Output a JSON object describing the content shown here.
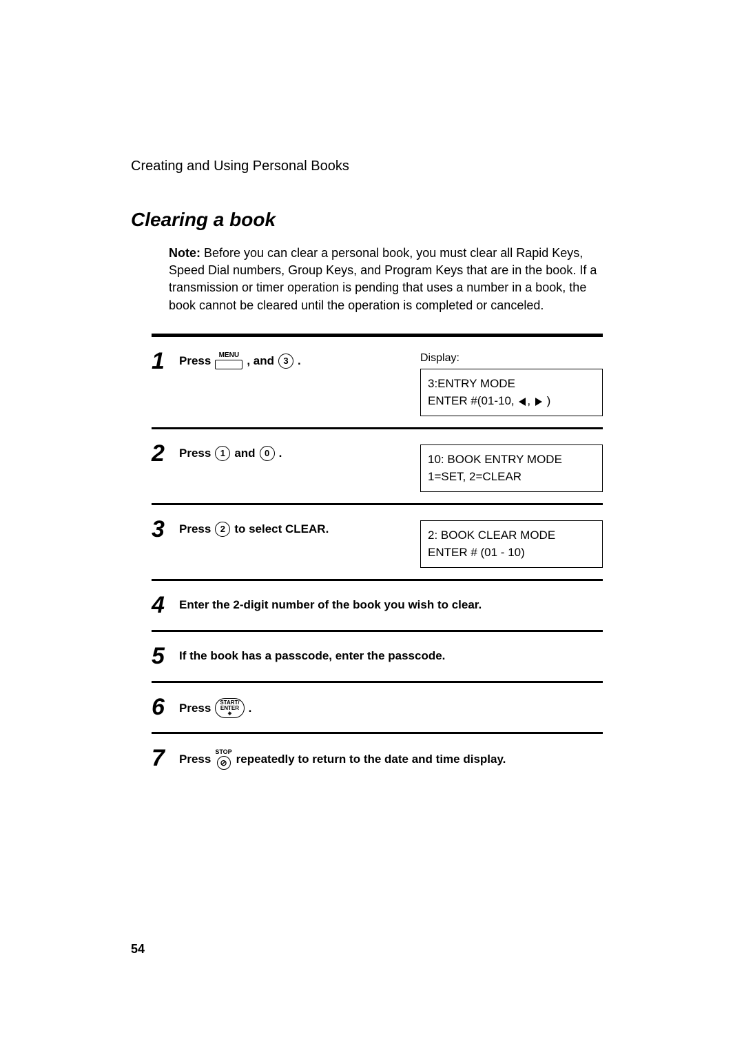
{
  "breadcrumb": "Creating and Using Personal Books",
  "section_title": "Clearing a book",
  "note": {
    "label": "Note:",
    "text": " Before you can clear a personal book, you must clear all Rapid Keys, Speed Dial numbers, Group Keys, and Program Keys that are in the book. If a transmission or timer operation is pending that uses a number in a book, the book cannot be cleared until the operation is completed or canceled."
  },
  "steps": [
    {
      "num": "1",
      "press": "Press",
      "menu_label": "MENU",
      "and": ", and",
      "key3": "3",
      "end": ".",
      "display_label": "Display:",
      "display_line1": "3:ENTRY MODE",
      "display_line2_a": "ENTER #(01-10, ",
      "display_line2_b": ", ",
      "display_line2_c": " )"
    },
    {
      "num": "2",
      "press": "Press",
      "key1": "1",
      "and": "and",
      "key0": "0",
      "end": ".",
      "display_line1": "10: BOOK ENTRY MODE",
      "display_line2": "1=SET, 2=CLEAR"
    },
    {
      "num": "3",
      "press": "Press",
      "key2": "2",
      "rest": "to select CLEAR.",
      "display_line1": "2: BOOK CLEAR MODE",
      "display_line2": "ENTER # (01 - 10)"
    },
    {
      "num": "4",
      "text": "Enter the 2-digit number of the book you wish to clear."
    },
    {
      "num": "5",
      "text": "If the book has a passcode, enter the passcode."
    },
    {
      "num": "6",
      "press": "Press",
      "start_l1": "START/",
      "start_l2": "ENTER",
      "end": "."
    },
    {
      "num": "7",
      "press": "Press",
      "stop_label": "STOP",
      "rest": "repeatedly to return to the date and time display."
    }
  ],
  "page_number": "54"
}
